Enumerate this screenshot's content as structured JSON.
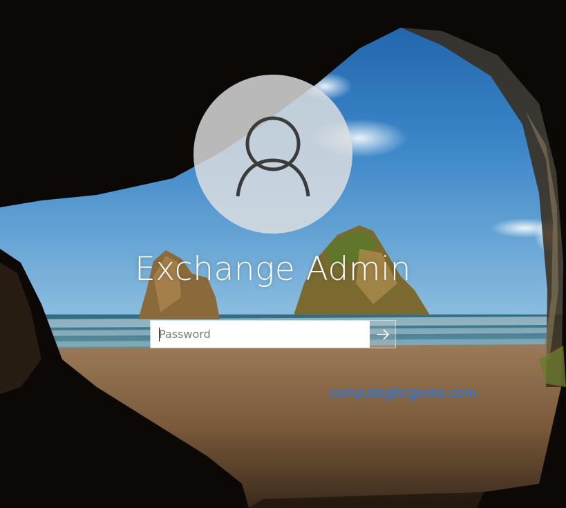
{
  "login": {
    "user_name": "Exchange Admin",
    "password_placeholder": "Password",
    "avatar_icon": "user-silhouette-icon",
    "submit_icon": "arrow-right-icon"
  },
  "watermark": {
    "text": "computingforgeeks.com",
    "color": "#1e7bf0"
  },
  "background": {
    "description_icon": "cave-beach-wallpaper"
  }
}
